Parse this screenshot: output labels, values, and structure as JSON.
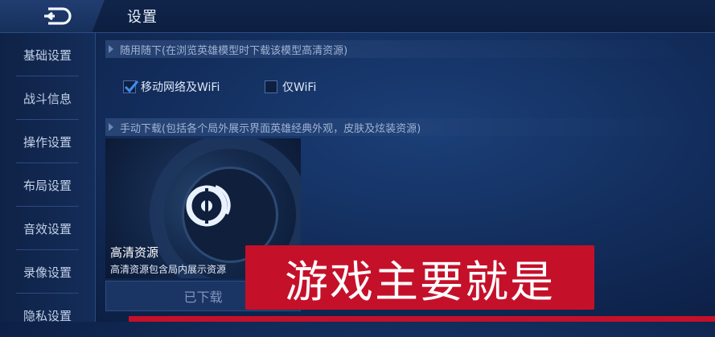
{
  "header": {
    "title": "设置",
    "back_icon": "back-arrow-icon"
  },
  "sidebar": {
    "items": [
      {
        "label": "基础设置"
      },
      {
        "label": "战斗信息"
      },
      {
        "label": "操作设置"
      },
      {
        "label": "布局设置"
      },
      {
        "label": "音效设置"
      },
      {
        "label": "录像设置"
      },
      {
        "label": "隐私设置"
      }
    ]
  },
  "main": {
    "section1": {
      "title": "随用随下(在浏览英雄模型时下载该模型高清资源)",
      "options": [
        {
          "label": "移动网络及WiFi",
          "checked": true
        },
        {
          "label": "仅WiFi",
          "checked": false
        }
      ]
    },
    "section2": {
      "title": "手动下载(包括各个局外展示界面英雄经典外观，皮肤及炫装资源)",
      "card": {
        "title": "高清资源",
        "description": "高清资源包含局内展示资源",
        "button_label": "已下载"
      }
    }
  },
  "overlay": {
    "caption": "游戏主要就是"
  },
  "colors": {
    "accent": "#2f7fe0",
    "caption_bg": "#c5102a",
    "background": "#112a57"
  }
}
